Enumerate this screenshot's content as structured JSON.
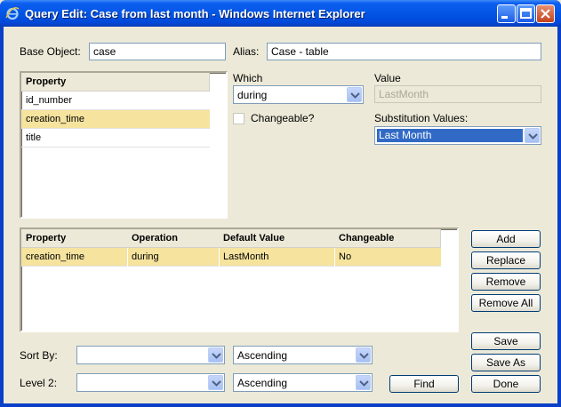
{
  "window": {
    "title": "Query Edit: Case from last month - Windows Internet Explorer"
  },
  "base_object": {
    "label": "Base Object:",
    "value": "case"
  },
  "alias": {
    "label": "Alias:",
    "value": "Case - table"
  },
  "property_list": {
    "header": "Property",
    "items": [
      "id_number",
      "creation_time",
      "title"
    ],
    "selected_index": 1
  },
  "which": {
    "label": "Which",
    "value": "during"
  },
  "value_field": {
    "label": "Value",
    "value": "LastMonth"
  },
  "changeable": {
    "label": "Changeable?",
    "checked": false
  },
  "substitution": {
    "label": "Substitution Values:",
    "value": "Last Month"
  },
  "criteria_grid": {
    "columns": [
      "Property",
      "Operation",
      "Default Value",
      "Changeable"
    ],
    "rows": [
      [
        "creation_time",
        "during",
        "LastMonth",
        "No"
      ]
    ]
  },
  "side_buttons": {
    "add": "Add",
    "replace": "Replace",
    "remove": "Remove",
    "remove_all": "Remove All",
    "save": "Save",
    "save_as": "Save As",
    "done": "Done"
  },
  "sort_by": {
    "label": "Sort By:",
    "field_value": "",
    "order_value": "Ascending"
  },
  "level2": {
    "label": "Level 2:",
    "field_value": "",
    "order_value": "Ascending"
  },
  "find_button": "Find",
  "colors": {
    "titlebar": "#0355e5",
    "selection_row": "#f5e39e",
    "selection_highlight": "#316ac5",
    "dialog_background": "#ece9d8"
  }
}
